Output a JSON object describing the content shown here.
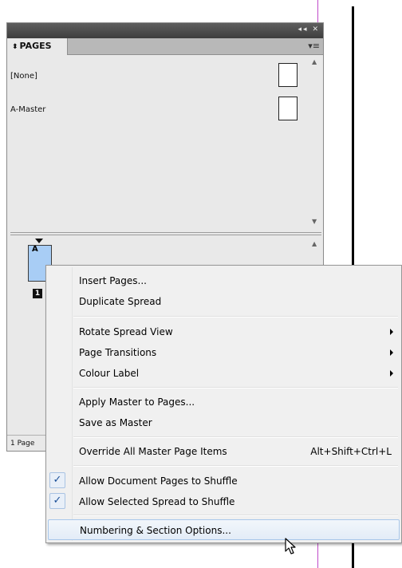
{
  "panel": {
    "title": "PAGES",
    "tab_icon": "double-arrow-icon",
    "masters": [
      {
        "label": "[None]"
      },
      {
        "label": "A-Master"
      }
    ],
    "page": {
      "prefix": "A",
      "number": "1"
    },
    "status_text": "1 Page"
  },
  "menu": {
    "items": [
      {
        "label": "Insert Pages...",
        "shortcut": "",
        "checked": false,
        "submenu": false
      },
      {
        "label": "Duplicate Spread",
        "shortcut": "",
        "checked": false,
        "submenu": false
      },
      {
        "label": "Rotate Spread View",
        "shortcut": "",
        "checked": false,
        "submenu": true
      },
      {
        "label": "Page Transitions",
        "shortcut": "",
        "checked": false,
        "submenu": true
      },
      {
        "label": "Colour Label",
        "shortcut": "",
        "checked": false,
        "submenu": true
      },
      {
        "label": "Apply Master to Pages...",
        "shortcut": "",
        "checked": false,
        "submenu": false
      },
      {
        "label": "Save as Master",
        "shortcut": "",
        "checked": false,
        "submenu": false
      },
      {
        "label": "Override All Master Page Items",
        "shortcut": "Alt+Shift+Ctrl+L",
        "checked": false,
        "submenu": false
      },
      {
        "label": "Allow Document Pages to Shuffle",
        "shortcut": "",
        "checked": true,
        "submenu": false
      },
      {
        "label": "Allow Selected Spread to Shuffle",
        "shortcut": "",
        "checked": true,
        "submenu": false
      },
      {
        "label": "Numbering & Section Options...",
        "shortcut": "",
        "checked": false,
        "submenu": false,
        "highlighted": true
      }
    ]
  },
  "colors": {
    "page_thumb": "#a8cdf5",
    "highlight_border": "#a8c7ea",
    "check": "#1b4f98"
  }
}
